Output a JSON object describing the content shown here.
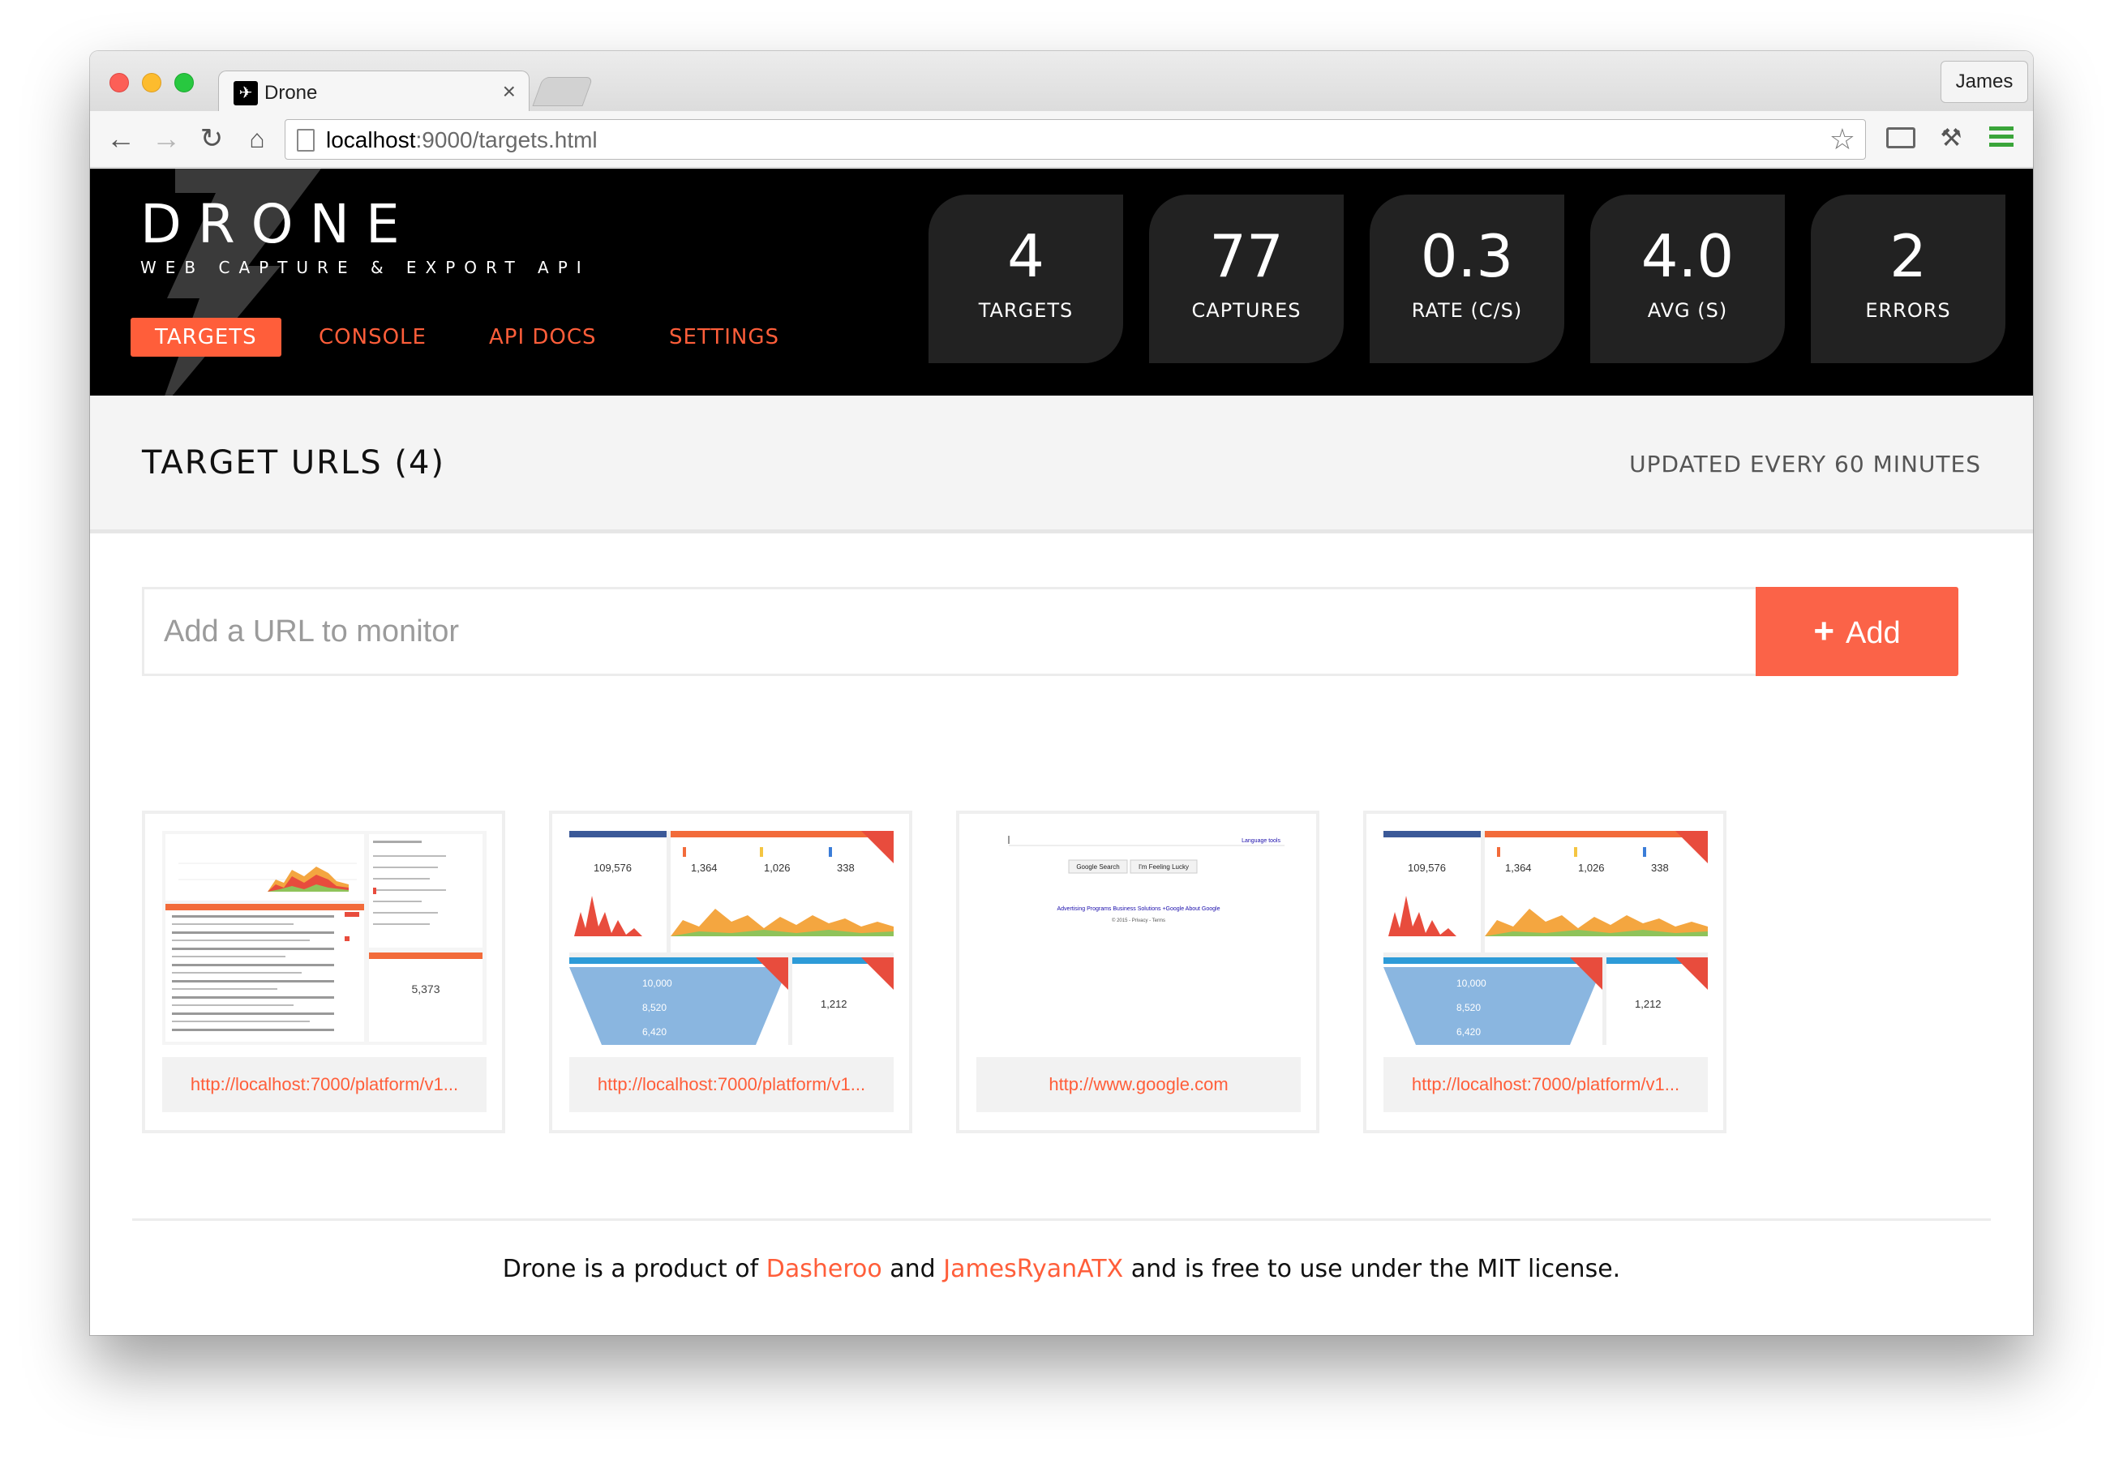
{
  "browser": {
    "tab_title": "Drone",
    "tab_close": "×",
    "profile": "James",
    "url_host": "localhost",
    "url_rest": ":9000/targets.html"
  },
  "brand": {
    "title": "DRONE",
    "subtitle": "WEB CAPTURE & EXPORT API"
  },
  "nav": {
    "items": [
      {
        "label": "TARGETS",
        "active": true
      },
      {
        "label": "CONSOLE",
        "active": false
      },
      {
        "label": "API DOCS",
        "active": false
      },
      {
        "label": "SETTINGS",
        "active": false
      }
    ]
  },
  "stats": [
    {
      "value": "4",
      "label": "TARGETS"
    },
    {
      "value": "77",
      "label": "CAPTURES"
    },
    {
      "value": "0.3",
      "label": "RATE (C/S)"
    },
    {
      "value": "4.0",
      "label": "AVG (S)"
    },
    {
      "value": "2",
      "label": "ERRORS"
    }
  ],
  "subheader": {
    "title": "TARGET URLS (4)",
    "note": "UPDATED EVERY 60 MINUTES"
  },
  "form": {
    "placeholder": "Add a URL to monitor",
    "add_label": "Add",
    "add_icon": "+"
  },
  "targets": [
    {
      "url": "http://localhost:7000/platform/v1...",
      "thumb": "dashboard-list"
    },
    {
      "url": "http://localhost:7000/platform/v1...",
      "thumb": "dashboard-widgets"
    },
    {
      "url": "http://www.google.com",
      "thumb": "google"
    },
    {
      "url": "http://localhost:7000/platform/v1...",
      "thumb": "dashboard-widgets"
    }
  ],
  "thumb_text": {
    "google_search": "Google Search",
    "feeling_lucky": "I'm Feeling Lucky",
    "language_tools": "Language tools",
    "google_links": "Advertising Programs   Business Solutions   +Google   About Google",
    "google_copyright": "© 2015 - Privacy - Terms",
    "widget_values": [
      "109,576",
      "1,364",
      "1,026",
      "338",
      "10,000",
      "8,520",
      "6,420",
      "1,212"
    ],
    "list_value": "5,373"
  },
  "footer": {
    "prefix": "Drone is a product of ",
    "link1": "Dasheroo",
    "middle": " and ",
    "link2": "JamesRyanATX",
    "suffix": " and is free to use under the MIT license."
  },
  "colors": {
    "accent": "#ff5e3a",
    "header_bg": "#000000",
    "stat_bg": "#222222"
  }
}
